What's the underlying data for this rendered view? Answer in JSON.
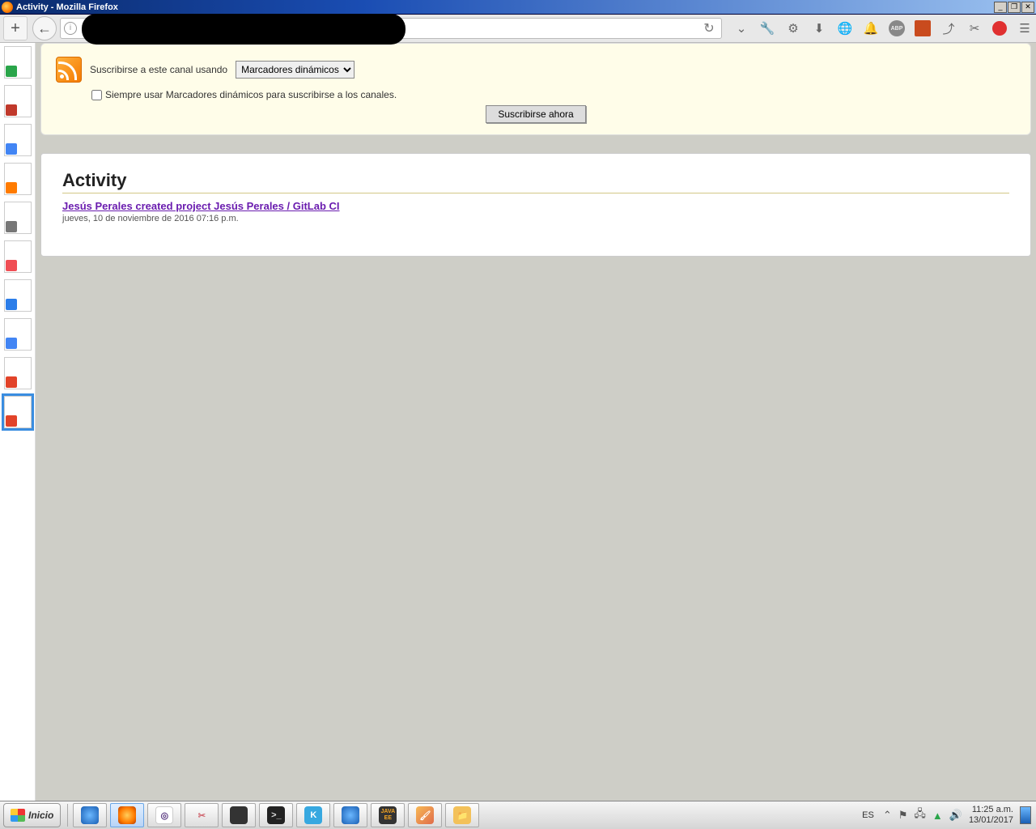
{
  "titlebar": {
    "title": "Activity - Mozilla Firefox"
  },
  "toolbar": {
    "new_tab": "+",
    "back": "←",
    "reload": "↻",
    "icon_names": [
      "pocket",
      "wrench",
      "gear",
      "download",
      "globe",
      "notif",
      "abp",
      "square",
      "share-up",
      "scissors",
      "red-dot",
      "menu"
    ]
  },
  "thumbs": [
    {
      "corner": "#2aa54a"
    },
    {
      "corner": "#c0392b"
    },
    {
      "corner": "#4285f4"
    },
    {
      "corner": "#ff7b00"
    },
    {
      "corner": "#777"
    },
    {
      "corner": "#f04e54"
    },
    {
      "corner": "#2b7de9"
    },
    {
      "corner": "#4285f4"
    },
    {
      "corner": "#e24329"
    },
    {
      "corner": "#e24329",
      "selected": true
    }
  ],
  "rss": {
    "label": "Suscribirse a este canal usando",
    "select": "Marcadores dinámicos",
    "check_label": "Siempre usar Marcadores dinámicos para suscribirse a los canales.",
    "btn": "Suscribirse ahora"
  },
  "activity": {
    "heading": "Activity",
    "item_link": "Jesús Perales created project Jesús Perales / GitLab CI",
    "item_date": "jueves, 10 de noviembre de 2016 07:16 p.m."
  },
  "taskbar": {
    "start": "Inicio",
    "lang": "ES",
    "time": "11:25 a.m.",
    "date": "13/01/2017"
  }
}
